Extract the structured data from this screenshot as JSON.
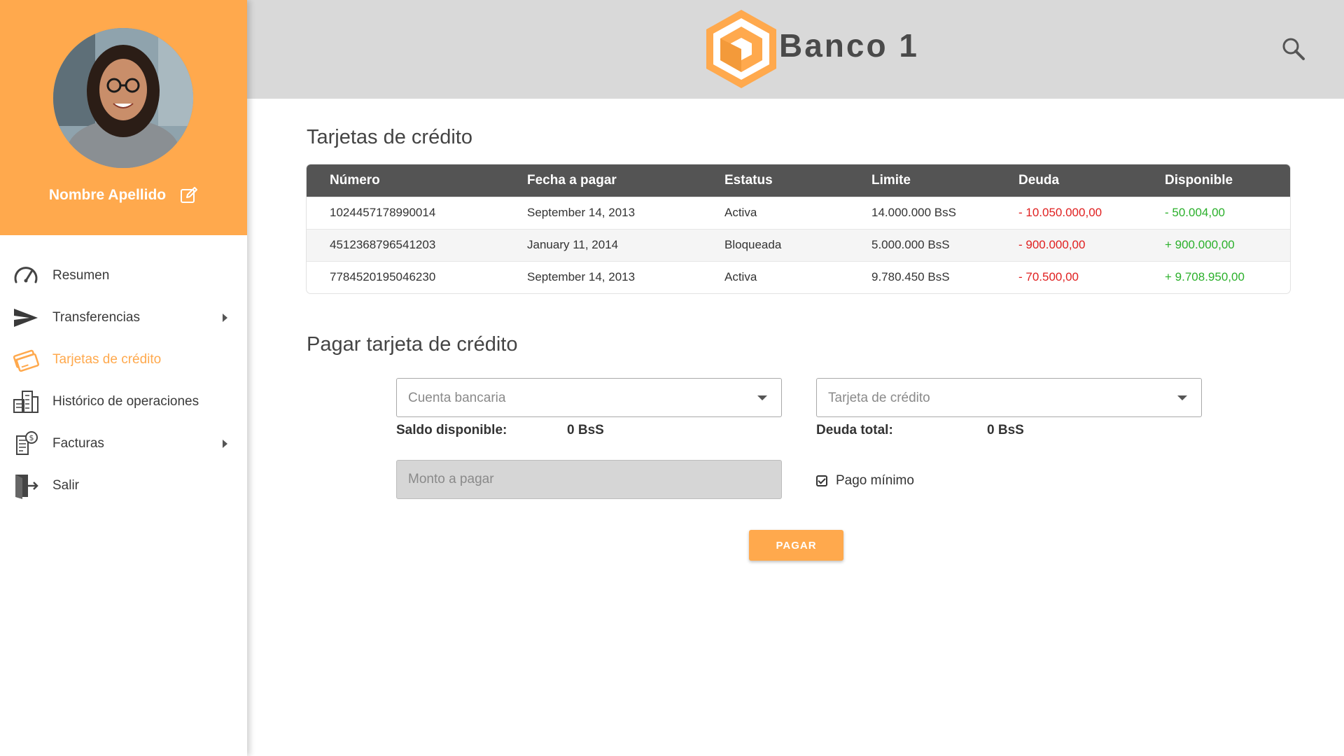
{
  "profile": {
    "name": "Nombre Apellido"
  },
  "nav": {
    "items": [
      {
        "label": "Resumen"
      },
      {
        "label": "Transferencias"
      },
      {
        "label": "Tarjetas de crédito"
      },
      {
        "label": "Histórico de operaciones"
      },
      {
        "label": "Facturas"
      },
      {
        "label": "Salir"
      }
    ],
    "active_index": 2
  },
  "header": {
    "brand": "Banco 1"
  },
  "cards_section": {
    "title": "Tarjetas de crédito",
    "columns": [
      "Número",
      "Fecha a pagar",
      "Estatus",
      "Limite",
      "Deuda",
      "Disponible"
    ],
    "rows": [
      [
        "1024457178990014",
        "September 14, 2013",
        "Activa",
        "14.000.000 BsS",
        "- 10.050.000,00",
        "- 50.004,00"
      ],
      [
        "4512368796541203",
        "January 11, 2014",
        "Bloqueada",
        "5.000.000 BsS",
        "- 900.000,00",
        "+ 900.000,00"
      ],
      [
        "7784520195046230",
        "September 14, 2013",
        "Activa",
        "9.780.450 BsS",
        "- 70.500,00",
        "+ 9.708.950,00"
      ]
    ]
  },
  "pay_section": {
    "title": "Pagar tarjeta de crédito",
    "account_placeholder": "Cuenta bancaria",
    "card_placeholder": "Tarjeta de crédito",
    "balance_label": "Saldo disponible:",
    "balance_value": "0 BsS",
    "debt_label": "Deuda total:",
    "debt_value": "0 BsS",
    "amount_placeholder": "Monto a pagar",
    "min_payment_label": "Pago mínimo",
    "min_payment_checked": true,
    "pay_button": "PAGAR"
  },
  "colors": {
    "accent": "#ffa94d",
    "header_bg": "#d9d9d9",
    "table_header": "#545454",
    "negative": "#e02020",
    "positive": "#2bb02b"
  },
  "icons": [
    "edit-icon",
    "speedometer-icon",
    "send-icon",
    "credit-card-icon",
    "building-history-icon",
    "invoice-icon",
    "exit-icon",
    "search-icon",
    "logo-icon"
  ]
}
